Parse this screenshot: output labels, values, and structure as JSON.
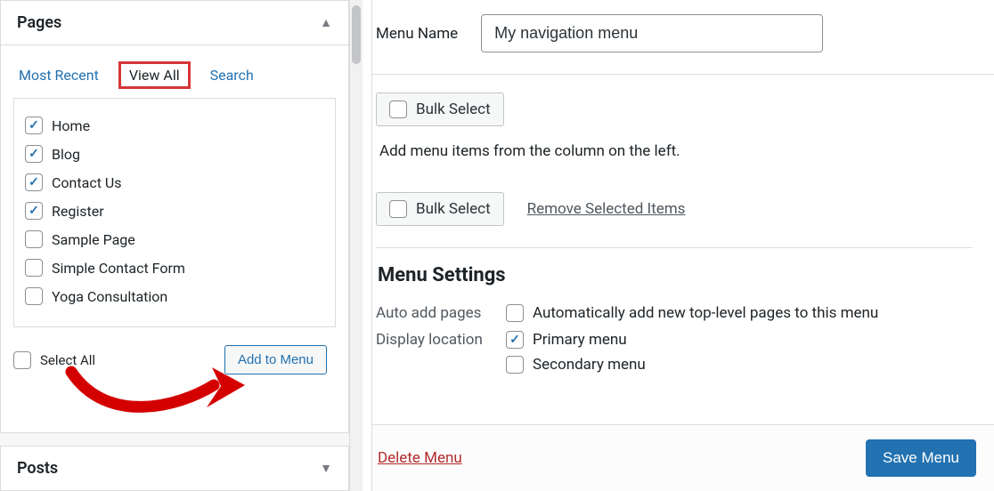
{
  "accordion": {
    "pages": {
      "title": "Pages",
      "expanded": true
    },
    "posts": {
      "title": "Posts",
      "expanded": false
    }
  },
  "tabs": {
    "most_recent": "Most Recent",
    "view_all": "View All",
    "search": "Search"
  },
  "pages_list": [
    {
      "label": "Home",
      "checked": true
    },
    {
      "label": "Blog",
      "checked": true
    },
    {
      "label": "Contact Us",
      "checked": true
    },
    {
      "label": "Register",
      "checked": true
    },
    {
      "label": "Sample Page",
      "checked": false
    },
    {
      "label": "Simple Contact Form",
      "checked": false
    },
    {
      "label": "Yoga Consultation",
      "checked": false
    }
  ],
  "select_all_label": "Select All",
  "add_to_menu_label": "Add to Menu",
  "menu_name": {
    "label": "Menu Name",
    "value": "My navigation menu"
  },
  "bulk_select_label": "Bulk Select",
  "hint_text": "Add menu items from the column on the left.",
  "remove_selected_label": "Remove Selected Items",
  "menu_settings": {
    "heading": "Menu Settings",
    "auto_add": {
      "label": "Auto add pages",
      "option": "Automatically add new top-level pages to this menu",
      "checked": false
    },
    "display_location": {
      "label": "Display location",
      "options": [
        {
          "label": "Primary menu",
          "checked": true
        },
        {
          "label": "Secondary menu",
          "checked": false
        }
      ]
    }
  },
  "footer": {
    "delete": "Delete Menu",
    "save": "Save Menu"
  }
}
